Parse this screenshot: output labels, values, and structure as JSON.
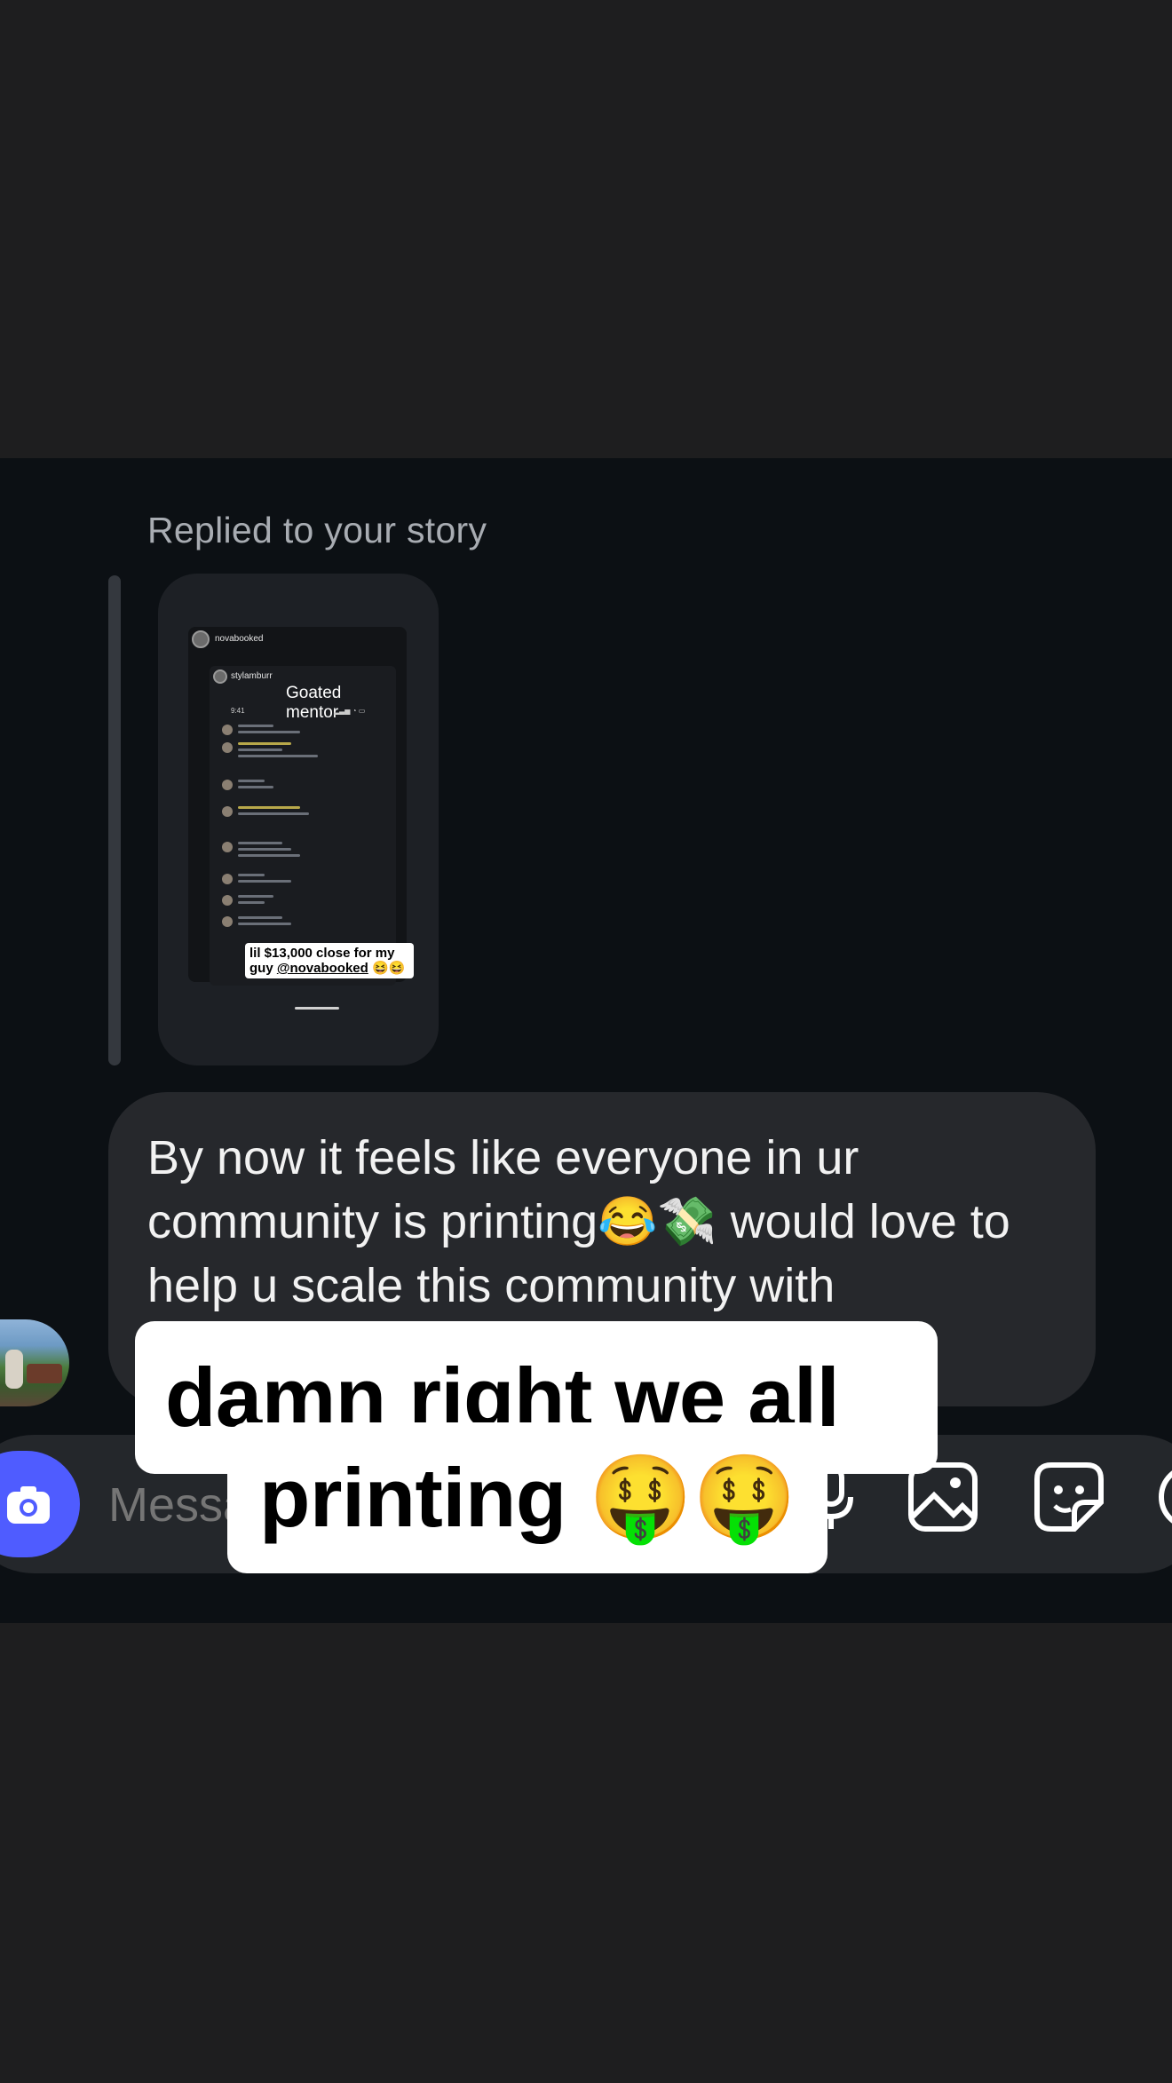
{
  "story_reply": {
    "label": "Replied to your story",
    "story": {
      "username": "novabooked",
      "inner_username": "stylamburr",
      "title": "Goated mentor",
      "time": "9:41",
      "caption_prefix": "lil $13,000 close for my guy ",
      "caption_mention": "@novabooked",
      "caption_emoji": "😆😆"
    }
  },
  "message": {
    "text": "By now it feels like everyone in ur community is printing😂💸 would love to help u scale this community with"
  },
  "composer": {
    "placeholder": "Message...",
    "icons": [
      "camera-icon",
      "microphone-icon",
      "gallery-icon",
      "sticker-icon",
      "add-icon"
    ]
  },
  "caption_overlay": {
    "line1": "damn right we all",
    "line2": "printing 🤑🤑"
  },
  "colors": {
    "background": "#1e1e1f",
    "chat_background": "#0c1014",
    "bubble": "#26282c",
    "camera_button": "#4f5cff",
    "overlay_box": "#ffffff"
  }
}
